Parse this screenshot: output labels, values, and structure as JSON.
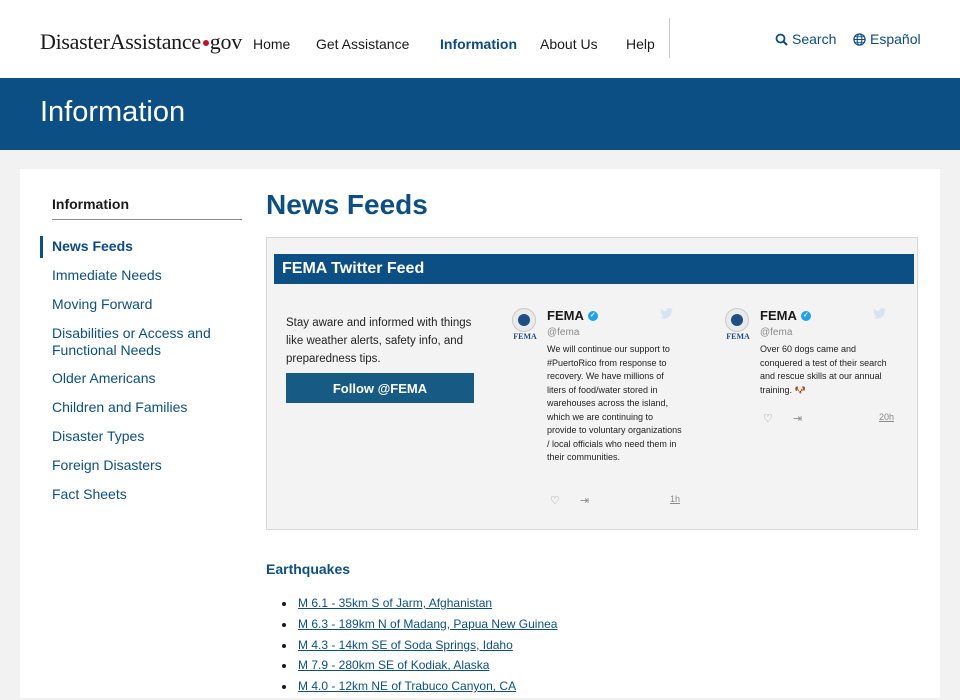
{
  "header": {
    "logo_main": "DisasterAssistance",
    "logo_suffix": "gov",
    "nav": [
      "Home",
      "Get Assistance",
      "Information",
      "About Us",
      "Help"
    ],
    "active_nav": "Information",
    "search_label": "Search",
    "language_label": "Español"
  },
  "banner": {
    "title": "Information"
  },
  "sidebar": {
    "title": "Information",
    "items": [
      "News Feeds",
      "Immediate Needs",
      "Moving Forward",
      "Disabilities or Access and Functional Needs",
      "Older Americans",
      "Children and Families",
      "Disaster Types",
      "Foreign Disasters",
      "Fact Sheets"
    ],
    "active_item": "News Feeds"
  },
  "main": {
    "title": "News Feeds",
    "twitter": {
      "heading": "FEMA Twitter Feed",
      "intro": "Stay aware and informed with things like weather alerts, safety info, and preparedness tips.",
      "follow_label": "Follow @FEMA",
      "tweets": [
        {
          "name": "FEMA",
          "avatar_text": "FEMA",
          "handle": "@fema",
          "text": "We will continue our support to #PuertoRico from response to recovery. We have millions of liters of food/water stored in warehouses across the island, which we are continuing to provide to voluntary organizations / local officials who need them in their communities.",
          "time": "1h"
        },
        {
          "name": "FEMA",
          "avatar_text": "FEMA",
          "handle": "@fema",
          "text": "Over 60 dogs came and conquered a test of their search and rescue skills at our annual training. 🐶",
          "time": "20h"
        }
      ]
    },
    "earthquakes": {
      "title": "Earthquakes",
      "items": [
        "M 6.1 - 35km S of Jarm, Afghanistan",
        "M 6.3 - 189km N of Madang, Papua New Guinea",
        "M 4.3 - 14km SE of Soda Springs, Idaho",
        "M 7.9 - 280km SE of Kodiak, Alaska",
        "M 4.0 - 12km NE of Trabuco Canyon, CA"
      ]
    }
  },
  "colors": {
    "brand_blue": "#0b4f85",
    "logo_dot": "#c8102e",
    "twitter_blue": "#1da1f2",
    "page_bg": "#f2f2f2"
  },
  "icons": {
    "search": "search-icon",
    "language": "globe-icon",
    "verified": "verified-check-icon",
    "twitter": "twitter-bird-icon",
    "like": "heart-icon",
    "share": "share-icon"
  }
}
